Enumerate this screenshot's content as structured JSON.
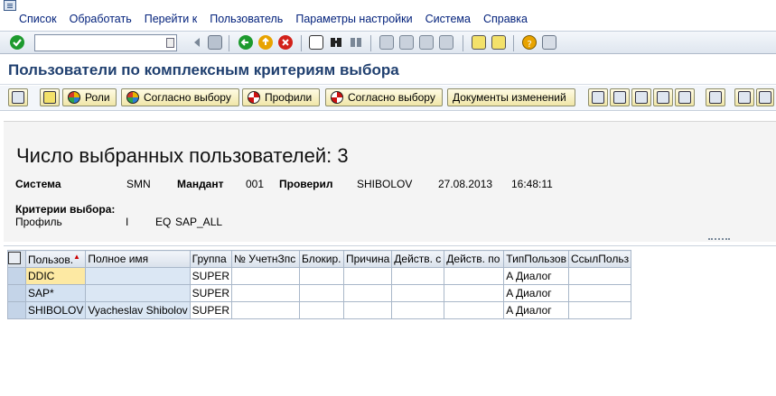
{
  "menu": {
    "items": [
      "Список",
      "Обработать",
      "Перейти к",
      "Пользователь",
      "Параметры настройки",
      "Система",
      "Справка"
    ]
  },
  "command_field": {
    "value": ""
  },
  "title": "Пользователи по комплексным критериям выбора",
  "app_toolbar": {
    "roles_label": "Роли",
    "by_selection_label_1": "Согласно выбору",
    "profiles_label": "Профили",
    "by_selection_label_2": "Согласно выбору",
    "change_docs_label": "Документы изменений"
  },
  "header": {
    "count_text": "Число выбранных пользователей: 3",
    "system_label": "Система",
    "system_value": "SMN",
    "client_label": "Мандант",
    "client_value": "001",
    "checked_label": "Проверил",
    "checked_value": "SHIBOLOV",
    "date": "27.08.2013",
    "time": "16:48:11",
    "criteria_label": "Критерии выбора:",
    "criteria_field": "Профиль",
    "criteria_sign": "I",
    "criteria_option": "EQ",
    "criteria_value": "SAP_ALL"
  },
  "grid": {
    "columns": [
      "Пользов.",
      "Полное имя",
      "Группа",
      "№ УчетнЗпс",
      "Блокир.",
      "Причина",
      "Действ. с",
      "Действ. по",
      "ТипПользов",
      "СсылПольз"
    ],
    "rows": [
      [
        "DDIC",
        "",
        "SUPER",
        "",
        "",
        "",
        "",
        "",
        "A Диалог",
        ""
      ],
      [
        "SAP*",
        "",
        "SUPER",
        "",
        "",
        "",
        "",
        "",
        "A Диалог",
        ""
      ],
      [
        "SHIBOLOV",
        "Vyacheslav Shibolov",
        "SUPER",
        "",
        "",
        "",
        "",
        "",
        "A Диалог",
        ""
      ]
    ]
  },
  "colors": {
    "title": "#1f3f6f",
    "menu_text": "#001f7a",
    "button_bg": "#f0e6a8",
    "grid_key_bg": "#d4e2f2",
    "grid_selected_bg": "#fde9a3"
  },
  "icons": {
    "ok": "green-check-icon",
    "save": "save-icon",
    "back": "back-arrow-icon",
    "exit": "exit-icon",
    "cancel": "cancel-icon",
    "print": "print-icon",
    "find": "binoculars-icon",
    "help": "help-icon"
  }
}
